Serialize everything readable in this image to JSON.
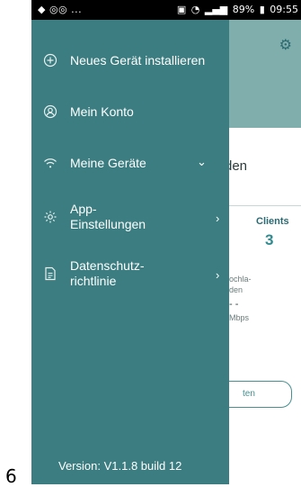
{
  "status_bar": {
    "left": "◆ ◎◎ ...",
    "battery": "89%",
    "time": "09:55"
  },
  "background": {
    "title_fragment": "den",
    "clients_label": "Clients",
    "clients_value": "3",
    "row1": "ochla-",
    "row2": "den",
    "dashes": "- -",
    "speed": "Mbps",
    "button_fragment": "ten"
  },
  "drawer": {
    "items": [
      {
        "label": "Neues Gerät installieren",
        "icon": "plus-circle-icon"
      },
      {
        "label": "Mein Konto",
        "icon": "account-icon"
      },
      {
        "label": "Meine Geräte",
        "icon": "wifi-icon"
      },
      {
        "label": "App-\nEinstellungen",
        "icon": "settings-icon"
      },
      {
        "label": "Datenschutz-\nrichtlinie",
        "icon": "document-icon"
      }
    ],
    "version": "Version: V1.1.8 build 12"
  },
  "page_number": "6"
}
